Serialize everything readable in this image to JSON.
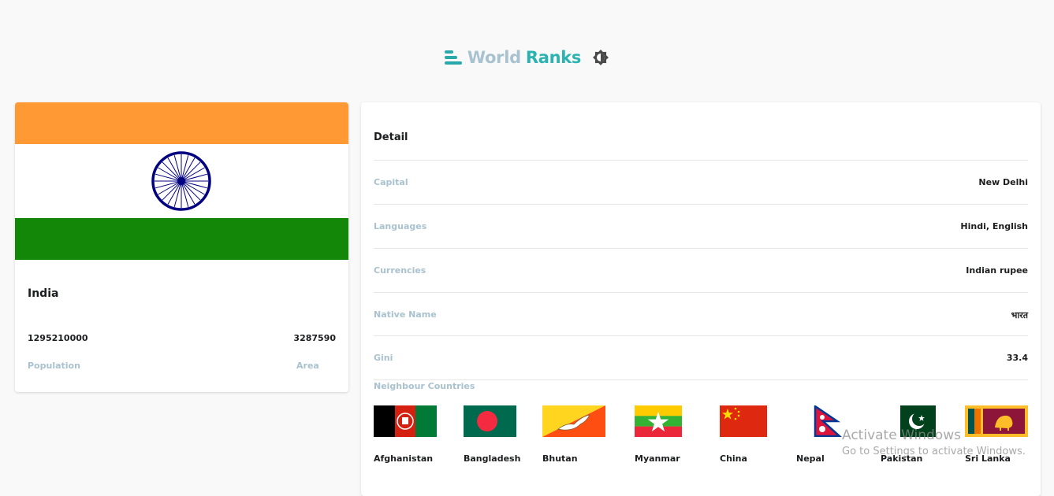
{
  "header": {
    "logo_icon": "bar-ranking-icon",
    "title_part1": "World",
    "title_part2": "Ranks",
    "theme_toggle_icon": "brightness-icon",
    "colors": {
      "accent": "#2bb3b1",
      "muted": "#a9c2cf"
    }
  },
  "country": {
    "name": "India",
    "flag_icon": "india-flag",
    "population": "1295210000",
    "population_label": "Population",
    "area": "3287590",
    "area_label": "Area"
  },
  "detail": {
    "title": "Detail",
    "rows": [
      {
        "label": "Capital",
        "value": "New Delhi"
      },
      {
        "label": "Languages",
        "value": "Hindi, English"
      },
      {
        "label": "Currencies",
        "value": "Indian rupee"
      },
      {
        "label": "Native Name",
        "value": "भारत"
      },
      {
        "label": "Gini",
        "value": "33.4"
      }
    ],
    "neighbours_title": "Neighbour Countries",
    "neighbours": [
      {
        "name": "Afghanistan",
        "flag_icon": "afghanistan-flag"
      },
      {
        "name": "Bangladesh",
        "flag_icon": "bangladesh-flag"
      },
      {
        "name": "Bhutan",
        "flag_icon": "bhutan-flag"
      },
      {
        "name": "Myanmar",
        "flag_icon": "myanmar-flag"
      },
      {
        "name": "China",
        "flag_icon": "china-flag"
      },
      {
        "name": "Nepal",
        "flag_icon": "nepal-flag"
      },
      {
        "name": "Pakistan",
        "flag_icon": "pakistan-flag"
      },
      {
        "name": "Sri Lanka",
        "flag_icon": "sri-lanka-flag"
      }
    ]
  },
  "watermark": {
    "title": "Activate Windows",
    "subtitle": "Go to Settings to activate Windows."
  }
}
